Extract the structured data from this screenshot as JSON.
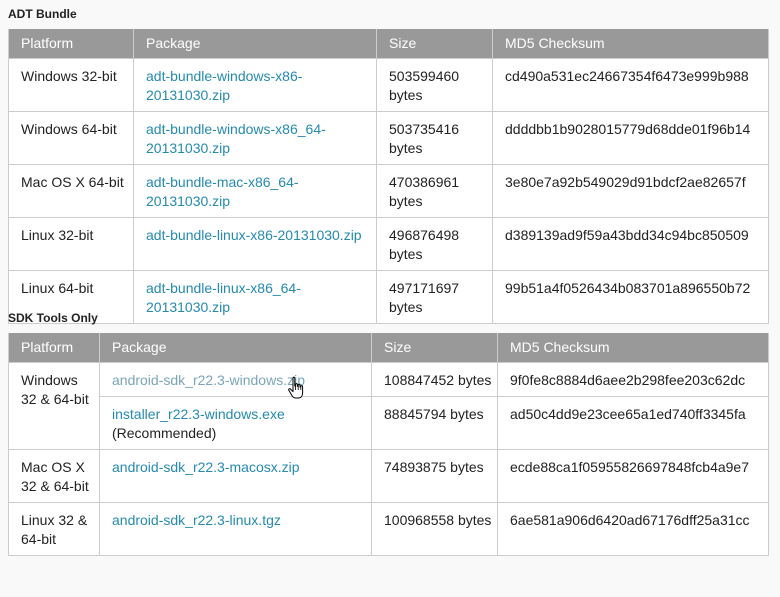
{
  "adt": {
    "title": "ADT Bundle",
    "headers": [
      "Platform",
      "Package",
      "Size",
      "MD5 Checksum"
    ],
    "rows": [
      {
        "platform": "Windows 32-bit",
        "package": "adt-bundle-windows-x86-20131030.zip",
        "size": "503599460 bytes",
        "md5": "cd490a531ec24667354f6473e999b988"
      },
      {
        "platform": "Windows 64-bit",
        "package": "adt-bundle-windows-x86_64-20131030.zip",
        "size": "503735416 bytes",
        "md5": "ddddbb1b9028015779d68dde01f96b14"
      },
      {
        "platform": "Mac OS X 64-bit",
        "package": "adt-bundle-mac-x86_64-20131030.zip",
        "size": "470386961 bytes",
        "md5": "3e80e7a92b549029d91bdcf2ae82657f"
      },
      {
        "platform": "Linux 32-bit",
        "package": "adt-bundle-linux-x86-20131030.zip",
        "size": "496876498 bytes",
        "md5": "d389139ad9f59a43bdd34c94bc850509"
      },
      {
        "platform": "Linux 64-bit",
        "package": "adt-bundle-linux-x86_64-20131030.zip",
        "size": "497171697 bytes",
        "md5": "99b51a4f0526434b083701a896550b72"
      }
    ]
  },
  "sdk": {
    "title": "SDK Tools Only",
    "headers": [
      "Platform",
      "Package",
      "Size",
      "MD5 Checksum"
    ],
    "windows_platform": "Windows 32 & 64-bit",
    "rows": [
      {
        "package": "android-sdk_r22.3-windows.zip",
        "size": "108847452 bytes",
        "md5": "9f0fe8c8884d6aee2b298fee203c62dc"
      },
      {
        "package": "installer_r22.3-windows.exe",
        "note": "(Recommended)",
        "size": "88845794 bytes",
        "md5": "ad50c4dd9e23cee65a1ed740ff3345fa"
      },
      {
        "platform": "Mac OS X 32 & 64-bit",
        "package": "android-sdk_r22.3-macosx.zip",
        "size": "74893875 bytes",
        "md5": "ecde88ca1f05955826697848fcb4a9e7"
      },
      {
        "platform": "Linux 32 & 64-bit",
        "package": "android-sdk_r22.3-linux.tgz",
        "size": "100968558 bytes",
        "md5": "6ae581a906d6420ad67176dff25a31cc"
      }
    ]
  },
  "cursor": {
    "icon": "hand-pointer-icon"
  }
}
